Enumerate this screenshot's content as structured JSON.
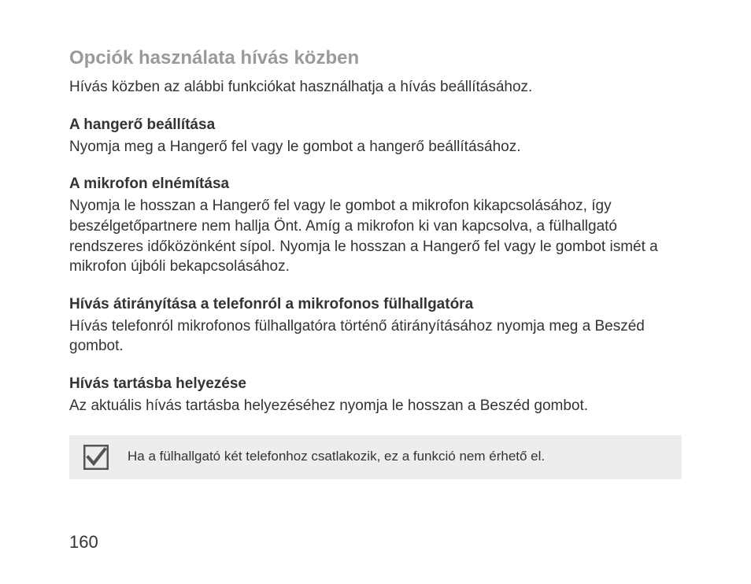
{
  "heading": "Opciók használata hívás közben",
  "intro": "Hívás közben az alábbi funkciókat használhatja a hívás beállításához.",
  "sections": [
    {
      "title": "A hangerő beállítása",
      "body": "Nyomja meg a Hangerő fel vagy le gombot a hangerő beállításához."
    },
    {
      "title": "A mikrofon elnémítása",
      "body": "Nyomja le hosszan a Hangerő fel vagy le gombot a mikrofon kikapcsolásához, így beszélgetőpartnere nem hallja Önt. Amíg a mikrofon ki van kapcsolva, a fülhallgató rendszeres időközönként sípol. Nyomja le hosszan a Hangerő fel vagy le gombot ismét a mikrofon újbóli bekapcsolásához."
    },
    {
      "title": "Hívás átirányítása a telefonról a mikrofonos fülhallgatóra",
      "body": "Hívás telefonról mikrofonos fülhallgatóra történő átirányításához nyomja meg a Beszéd gombot."
    },
    {
      "title": "Hívás tartásba helyezése",
      "body": "Az aktuális hívás tartásba helyezéséhez nyomja le hosszan a Beszéd gombot."
    }
  ],
  "note": "Ha a fülhallgató két telefonhoz csatlakozik, ez a funkció nem érhető el.",
  "pageNumber": "160"
}
